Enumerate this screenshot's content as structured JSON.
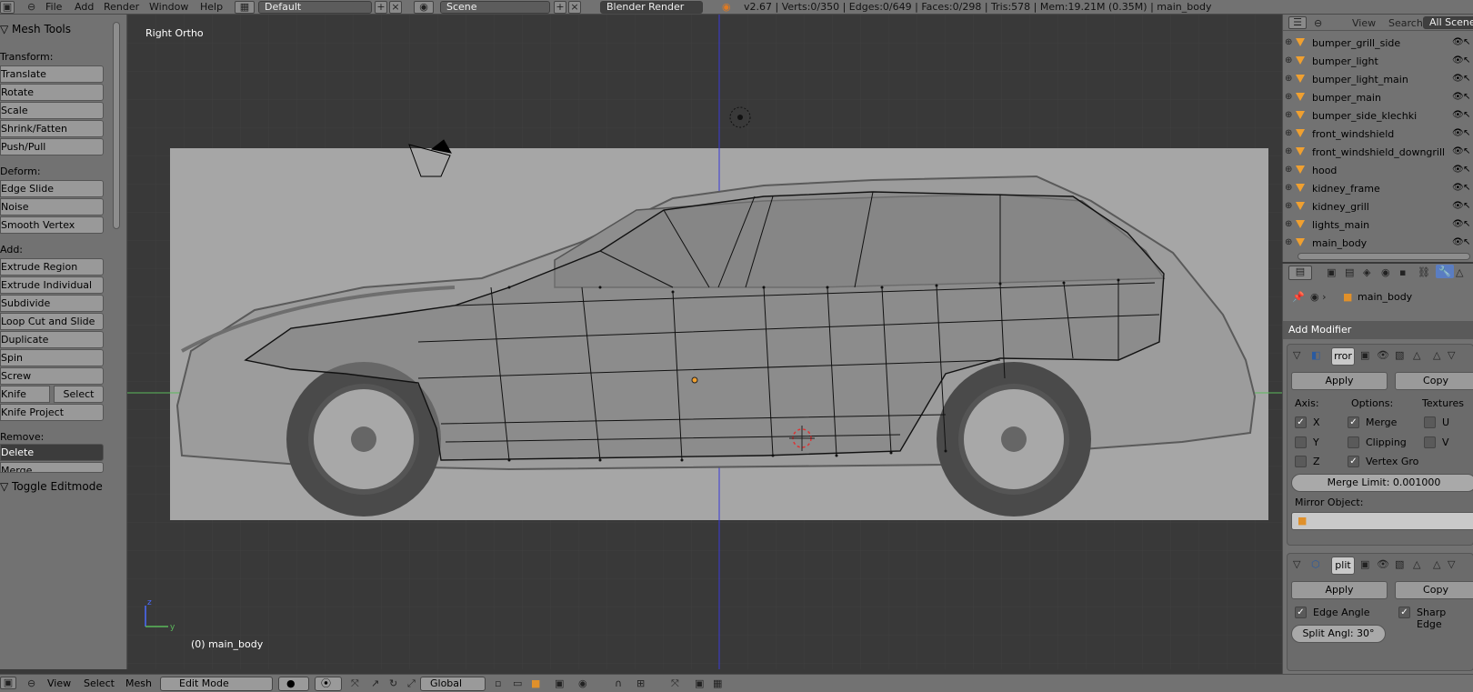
{
  "topbar": {
    "menus": [
      "File",
      "Add",
      "Render",
      "Window",
      "Help"
    ],
    "layout": "Default",
    "scene": "Scene",
    "engine": "Blender Render",
    "stats": "v2.67 | Verts:0/350 | Edges:0/649 | Faces:0/298 | Tris:578 | Mem:19.21M (0.35M) | main_body"
  },
  "toolshelf": {
    "title": "Mesh Tools",
    "transform_label": "Transform:",
    "transform": [
      "Translate",
      "Rotate",
      "Scale",
      "Shrink/Fatten",
      "Push/Pull"
    ],
    "deform_label": "Deform:",
    "deform": [
      "Edge Slide",
      "Noise",
      "Smooth Vertex"
    ],
    "add_label": "Add:",
    "add": [
      "Extrude Region",
      "Extrude Individual",
      "Subdivide",
      "Loop Cut and Slide",
      "Duplicate",
      "Spin",
      "Screw"
    ],
    "knife": "Knife",
    "select": "Select",
    "knife_project": "Knife Project",
    "remove_label": "Remove:",
    "delete": "Delete",
    "merge": "Merge",
    "toggle_editmode": "Toggle Editmode"
  },
  "viewport": {
    "view_name": "Right Ortho",
    "object_label": "(0) main_body"
  },
  "outliner": {
    "view": "View",
    "search": "Search",
    "filter": "All Scene",
    "items": [
      "bumper_grill_side",
      "bumper_light",
      "bumper_light_main",
      "bumper_main",
      "bumper_side_klechki",
      "front_windshield",
      "front_windshield_downgrill",
      "hood",
      "kidney_frame",
      "kidney_grill",
      "lights_main",
      "main_body"
    ]
  },
  "properties": {
    "object_name": "main_body",
    "add_modifier": "Add Modifier",
    "mirror": {
      "name": "rror",
      "apply": "Apply",
      "copy": "Copy",
      "axis_label": "Axis:",
      "options_label": "Options:",
      "textures_label": "Textures",
      "x": "X",
      "y": "Y",
      "z": "Z",
      "merge": "Merge",
      "clipping": "Clipping",
      "vertex_groups": "Vertex Gro",
      "u": "U",
      "v": "V",
      "merge_limit": "Merge Limit: 0.001000",
      "mirror_object": "Mirror Object:"
    },
    "split": {
      "name": "plit",
      "apply": "Apply",
      "copy": "Copy",
      "edge_angle": "Edge Angle",
      "sharp_edges": "Sharp Edge",
      "split_angle": "Split Angl: 30°"
    }
  },
  "bottombar": {
    "menus": [
      "View",
      "Select",
      "Mesh"
    ],
    "mode": "Edit Mode",
    "orientation": "Global"
  }
}
